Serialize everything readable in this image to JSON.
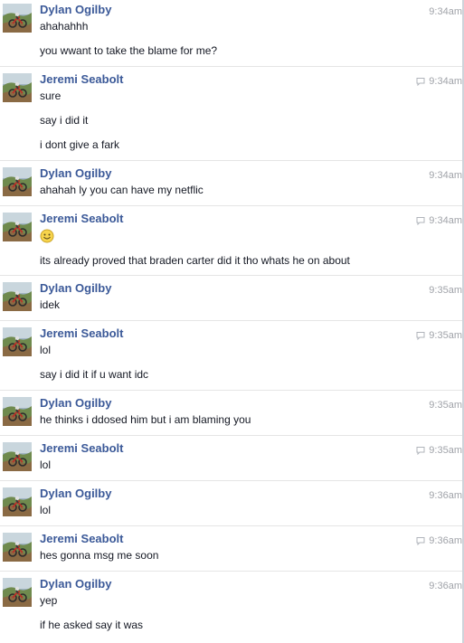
{
  "groups": [
    {
      "sender": "Dylan Ogilby",
      "time": "9:34am",
      "seen": false,
      "messages": [
        "ahahahhh",
        "you wwant to take the blame for me?"
      ]
    },
    {
      "sender": "Jeremi Seabolt",
      "time": "9:34am",
      "seen": true,
      "messages": [
        "sure",
        "say i did it",
        "i dont give a fark"
      ]
    },
    {
      "sender": "Dylan Ogilby",
      "time": "9:34am",
      "seen": false,
      "messages": [
        "ahahah ly you can have my netflic"
      ]
    },
    {
      "sender": "Jeremi Seabolt",
      "time": "9:34am",
      "seen": true,
      "emoji": "smiley-emoji",
      "messages": [
        "its already proved that braden carter did it tho whats he on about"
      ]
    },
    {
      "sender": "Dylan Ogilby",
      "time": "9:35am",
      "seen": false,
      "messages": [
        "idek"
      ]
    },
    {
      "sender": "Jeremi Seabolt",
      "time": "9:35am",
      "seen": true,
      "messages": [
        "lol",
        "say i did it if u want idc"
      ]
    },
    {
      "sender": "Dylan Ogilby",
      "time": "9:35am",
      "seen": false,
      "messages": [
        "he thinks i ddosed him but i am blaming you"
      ]
    },
    {
      "sender": "Jeremi Seabolt",
      "time": "9:35am",
      "seen": true,
      "messages": [
        "lol"
      ]
    },
    {
      "sender": "Dylan Ogilby",
      "time": "9:36am",
      "seen": false,
      "messages": [
        "lol"
      ]
    },
    {
      "sender": "Jeremi Seabolt",
      "time": "9:36am",
      "seen": true,
      "messages": [
        "hes gonna msg me soon"
      ]
    },
    {
      "sender": "Dylan Ogilby",
      "time": "9:36am",
      "seen": false,
      "messages": [
        "yep",
        "if he asked say it was"
      ]
    }
  ],
  "colors": {
    "sender_name": "#3b5998",
    "timestamp": "#a0a3a9",
    "message_text": "#141823",
    "divider": "#e5e5e5"
  },
  "icons": {
    "avatar": "avatar-photo-icon",
    "seen": "seen-message-icon"
  }
}
